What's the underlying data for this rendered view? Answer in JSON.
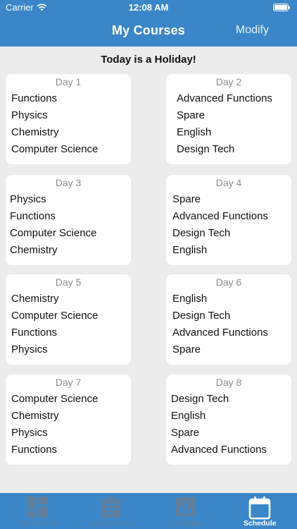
{
  "status_bar": {
    "carrier": "Carrier",
    "time": "12:08 AM"
  },
  "nav": {
    "title": "My Courses",
    "modify_label": "Modify"
  },
  "banner": "Today is a Holiday!",
  "days": [
    {
      "label": "Day 1",
      "courses": [
        "Functions",
        "Physics",
        "Chemistry",
        "Computer Science"
      ]
    },
    {
      "label": "Day 2",
      "courses": [
        "Advanced Functions",
        "Spare",
        "English",
        "Design Tech"
      ]
    },
    {
      "label": "Day 3",
      "courses": [
        "Physics",
        "Functions",
        "Computer Science",
        "Chemistry"
      ]
    },
    {
      "label": "Day 4",
      "courses": [
        "Spare",
        "Advanced Functions",
        "Design Tech",
        "English"
      ]
    },
    {
      "label": "Day 5",
      "courses": [
        "Chemistry",
        "Computer Science",
        "Functions",
        "Physics"
      ]
    },
    {
      "label": "Day 6",
      "courses": [
        "English",
        "Design Tech",
        "Advanced Functions",
        "Spare"
      ]
    },
    {
      "label": "Day 7",
      "courses": [
        "Computer Science",
        "Chemistry",
        "Physics",
        "Functions"
      ]
    },
    {
      "label": "Day 8",
      "courses": [
        "Design Tech",
        "English",
        "Spare",
        "Advanced Functions"
      ]
    }
  ],
  "tabs": [
    {
      "label": "Dashboard",
      "icon": "dashboard-icon",
      "active": false
    },
    {
      "label": "Assignments",
      "icon": "assignments-icon",
      "active": false
    },
    {
      "label": "Calculator",
      "icon": "calculator-icon",
      "active": false
    },
    {
      "label": "Schedule",
      "icon": "calendar-icon",
      "active": true
    }
  ],
  "colors": {
    "primary": "#3a86c8",
    "background": "#ececec",
    "card": "#ffffff",
    "day_label": "#8d8d8d",
    "inactive_tab": "#5f7e9c"
  }
}
